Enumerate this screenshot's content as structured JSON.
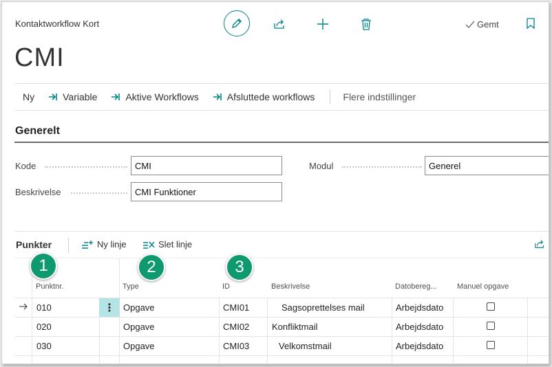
{
  "header": {
    "breadcrumb": "Kontaktworkflow Kort",
    "title": "CMI",
    "saved_label": "Gemt"
  },
  "actions": {
    "new": "Ny",
    "variable": "Variable",
    "active_workflows": "Aktive Workflows",
    "finished_workflows": "Afsluttede workflows",
    "more_settings": "Flere indstillinger"
  },
  "general": {
    "title": "Generelt",
    "code_label": "Kode",
    "code_value": "CMI",
    "description_label": "Beskrivelse",
    "description_value": "CMI Funktioner",
    "module_label": "Modul",
    "module_value": "Generel"
  },
  "lines": {
    "title": "Punkter",
    "new_line": "Ny linje",
    "delete_line": "Slet linje",
    "columns": [
      "Punktnr.",
      "Type",
      "ID",
      "Beskrivelse",
      "Datobereg...",
      "Manuel opgave"
    ],
    "rows": [
      {
        "no": "010",
        "type": "Opgave",
        "id": "CMI01",
        "description": "Sagsoprettelses mail",
        "date": "Arbejdsdato",
        "manual": false
      },
      {
        "no": "020",
        "type": "Opgave",
        "id": "CMI02",
        "description": "Konfliktmail",
        "date": "Arbejdsdato",
        "manual": false
      },
      {
        "no": "030",
        "type": "Opgave",
        "id": "CMI03",
        "description": "Velkomstmail",
        "date": "Arbejdsdato",
        "manual": false
      }
    ]
  },
  "badges": [
    "1",
    "2",
    "3"
  ],
  "colors": {
    "accent": "#00848a",
    "badge": "#0e9a6e",
    "selected_cell": "#b4e4e6"
  }
}
